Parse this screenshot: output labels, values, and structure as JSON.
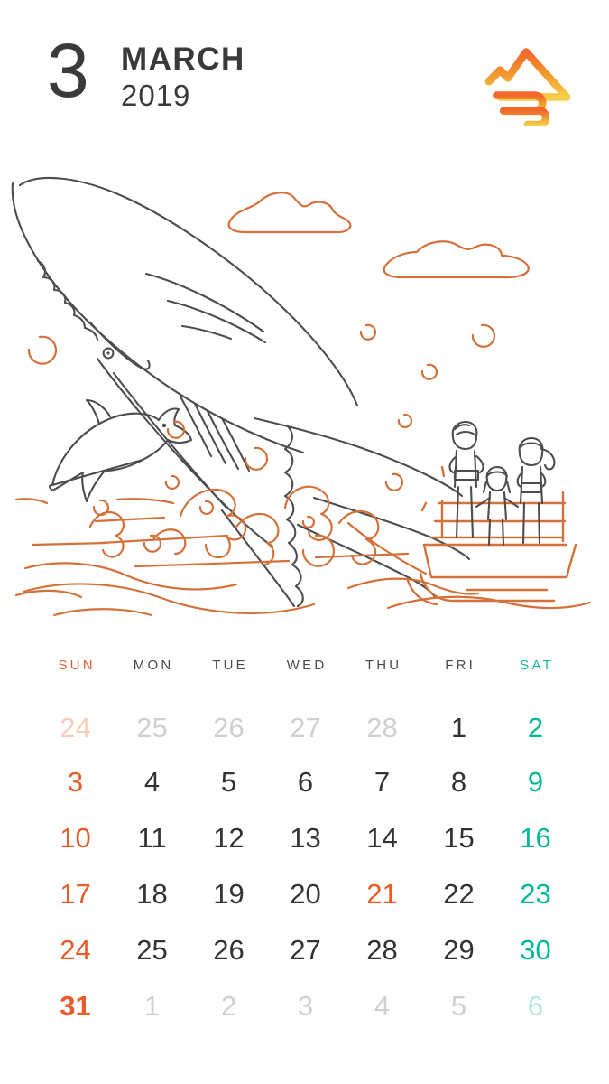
{
  "header": {
    "month_number": "3",
    "month_name": "MARCH",
    "year": "2019",
    "logo_name": "mountain-wave-logo",
    "logo_colors": {
      "top": "#F2682B",
      "mid": "#F0982E",
      "bottom": "#F7CE4B"
    }
  },
  "illustration": {
    "name": "humpback-whale-watching-scene",
    "elements": [
      "humpback-whale",
      "dolphin",
      "tour-boat",
      "three-passengers",
      "clouds",
      "water-splash",
      "bubbles",
      "waves"
    ],
    "line_color_dark": "#4a4a4a",
    "line_color_orange": "#d4703a"
  },
  "calendar": {
    "weekdays": [
      {
        "label": "SUN",
        "tone": "sun"
      },
      {
        "label": "MON",
        "tone": "normal"
      },
      {
        "label": "TUE",
        "tone": "normal"
      },
      {
        "label": "WED",
        "tone": "normal"
      },
      {
        "label": "THU",
        "tone": "normal"
      },
      {
        "label": "FRI",
        "tone": "normal"
      },
      {
        "label": "SAT",
        "tone": "sat"
      }
    ],
    "weeks": [
      [
        {
          "n": "24",
          "type": "out-sun"
        },
        {
          "n": "25",
          "type": "out"
        },
        {
          "n": "26",
          "type": "out"
        },
        {
          "n": "27",
          "type": "out"
        },
        {
          "n": "28",
          "type": "out"
        },
        {
          "n": "1",
          "type": "normal"
        },
        {
          "n": "2",
          "type": "sat"
        }
      ],
      [
        {
          "n": "3",
          "type": "sun"
        },
        {
          "n": "4",
          "type": "normal"
        },
        {
          "n": "5",
          "type": "normal"
        },
        {
          "n": "6",
          "type": "normal"
        },
        {
          "n": "7",
          "type": "normal"
        },
        {
          "n": "8",
          "type": "normal"
        },
        {
          "n": "9",
          "type": "sat"
        }
      ],
      [
        {
          "n": "10",
          "type": "sun"
        },
        {
          "n": "11",
          "type": "normal"
        },
        {
          "n": "12",
          "type": "normal"
        },
        {
          "n": "13",
          "type": "normal"
        },
        {
          "n": "14",
          "type": "normal"
        },
        {
          "n": "15",
          "type": "normal"
        },
        {
          "n": "16",
          "type": "sat"
        }
      ],
      [
        {
          "n": "17",
          "type": "sun"
        },
        {
          "n": "18",
          "type": "normal"
        },
        {
          "n": "19",
          "type": "normal"
        },
        {
          "n": "20",
          "type": "normal"
        },
        {
          "n": "21",
          "type": "holiday"
        },
        {
          "n": "22",
          "type": "normal"
        },
        {
          "n": "23",
          "type": "sat"
        }
      ],
      [
        {
          "n": "24",
          "type": "sun"
        },
        {
          "n": "25",
          "type": "normal"
        },
        {
          "n": "26",
          "type": "normal"
        },
        {
          "n": "27",
          "type": "normal"
        },
        {
          "n": "28",
          "type": "normal"
        },
        {
          "n": "29",
          "type": "normal"
        },
        {
          "n": "30",
          "type": "sat"
        }
      ],
      [
        {
          "n": "31",
          "type": "sun-bold"
        },
        {
          "n": "1",
          "type": "out"
        },
        {
          "n": "2",
          "type": "out"
        },
        {
          "n": "3",
          "type": "out"
        },
        {
          "n": "4",
          "type": "out"
        },
        {
          "n": "5",
          "type": "out"
        },
        {
          "n": "6",
          "type": "out-sat"
        }
      ]
    ],
    "colors": {
      "sunday": "#ea5b2a",
      "saturday": "#00b897",
      "weekday": "#333333",
      "holiday": "#f2581f",
      "outside_month": "#cfcfcf"
    }
  }
}
